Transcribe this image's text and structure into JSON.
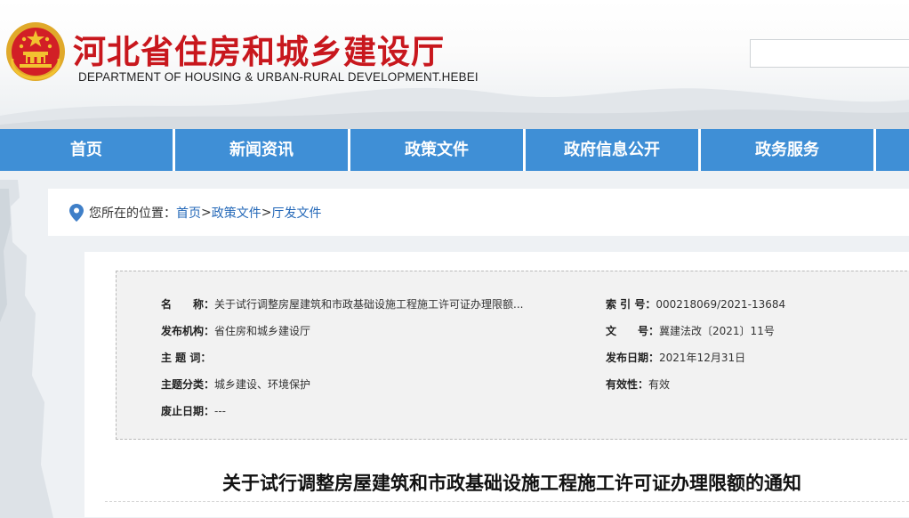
{
  "header": {
    "title": "河北省住房和城乡建设厅",
    "subtitle": "DEPARTMENT OF HOUSING & URBAN-RURAL DEVELOPMENT.HEBEI",
    "search_placeholder": ""
  },
  "nav": {
    "items": [
      {
        "label": "首页"
      },
      {
        "label": "新闻资讯"
      },
      {
        "label": "政策文件"
      },
      {
        "label": "政府信息公开"
      },
      {
        "label": "政务服务"
      }
    ]
  },
  "breadcrumb": {
    "prefix": "您所在的位置：",
    "items": [
      "首页",
      "政策文件",
      "厅发文件"
    ],
    "separator": ">"
  },
  "info": {
    "name_label": "名　　称：",
    "name_value": "关于试行调整房屋建筑和市政基础设施工程施工许可证办理限额...",
    "index_label": "索 引 号：",
    "index_value": "000218069/2021-13684",
    "org_label": "发布机构：",
    "org_value": "省住房和城乡建设厅",
    "docno_label": "文　　号：",
    "docno_value": "冀建法改〔2021〕11号",
    "keyword_label": "主 题 词：",
    "keyword_value": "",
    "date_label": "发布日期：",
    "date_value": "2021年12月31日",
    "category_label": "主题分类：",
    "category_value": "城乡建设、环境保护",
    "validity_label": "有效性：",
    "validity_value": "有效",
    "expire_label": "废止日期：",
    "expire_value": "---"
  },
  "article": {
    "title": "关于试行调整房屋建筑和市政基础设施工程施工许可证办理限额的通知"
  },
  "colors": {
    "brand_red": "#c8171d",
    "nav_blue": "#3f8fd6",
    "link_blue": "#2468b8"
  }
}
